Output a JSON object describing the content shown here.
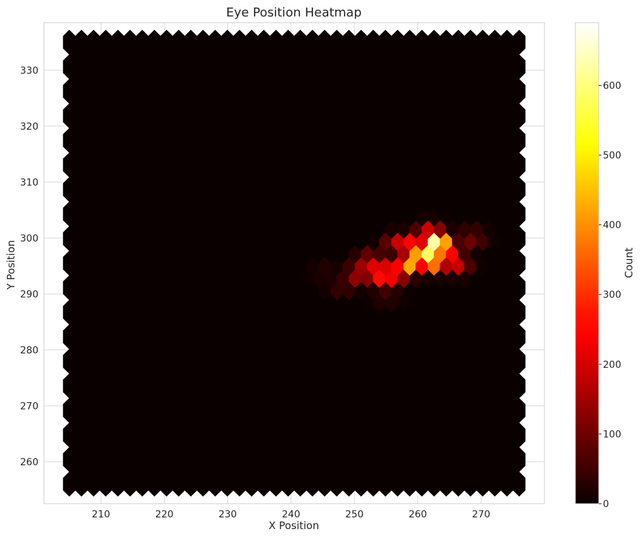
{
  "chart_data": {
    "type": "heatmap",
    "subtype": "hexbin",
    "title": "Eye Position Heatmap",
    "xlabel": "X Position",
    "ylabel": "Y Position",
    "xlim": [
      201,
      280
    ],
    "ylim": [
      252.5,
      338.5
    ],
    "xticks": [
      210,
      220,
      230,
      240,
      250,
      260,
      270
    ],
    "yticks": [
      260,
      270,
      280,
      290,
      300,
      310,
      320,
      330
    ],
    "grid": true,
    "colormap": "hot",
    "colorbar": {
      "label": "Count",
      "range": [
        0,
        690
      ],
      "ticks": [
        0,
        100,
        200,
        300,
        400,
        500,
        600
      ]
    },
    "hexbin_extent": {
      "x": [
        205,
        276
      ],
      "y": [
        256,
        335
      ]
    },
    "hot_spots": [
      {
        "x": 263,
        "y": 299.5,
        "value": 690
      },
      {
        "x": 262,
        "y": 298,
        "value": 620
      },
      {
        "x": 260.5,
        "y": 297,
        "value": 560
      },
      {
        "x": 262.5,
        "y": 296.5,
        "value": 520
      },
      {
        "x": 258.5,
        "y": 296,
        "value": 470
      },
      {
        "x": 256,
        "y": 294.5,
        "value": 380
      },
      {
        "x": 254,
        "y": 294,
        "value": 310
      },
      {
        "x": 259,
        "y": 299,
        "value": 330
      },
      {
        "x": 252.5,
        "y": 296,
        "value": 240
      },
      {
        "x": 264.5,
        "y": 297.5,
        "value": 300
      },
      {
        "x": 266,
        "y": 296,
        "value": 210
      },
      {
        "x": 262,
        "y": 301.5,
        "value": 220
      },
      {
        "x": 257,
        "y": 299.5,
        "value": 200
      },
      {
        "x": 250.5,
        "y": 294,
        "value": 160
      },
      {
        "x": 268.5,
        "y": 300.5,
        "value": 110
      },
      {
        "x": 248,
        "y": 292,
        "value": 60
      },
      {
        "x": 245.5,
        "y": 294.5,
        "value": 35
      },
      {
        "x": 255,
        "y": 290.5,
        "value": 60
      }
    ],
    "colors": {
      "background_bin": "#0b0000",
      "grid": "#d8d8d8",
      "spine": "#cccccc"
    }
  }
}
